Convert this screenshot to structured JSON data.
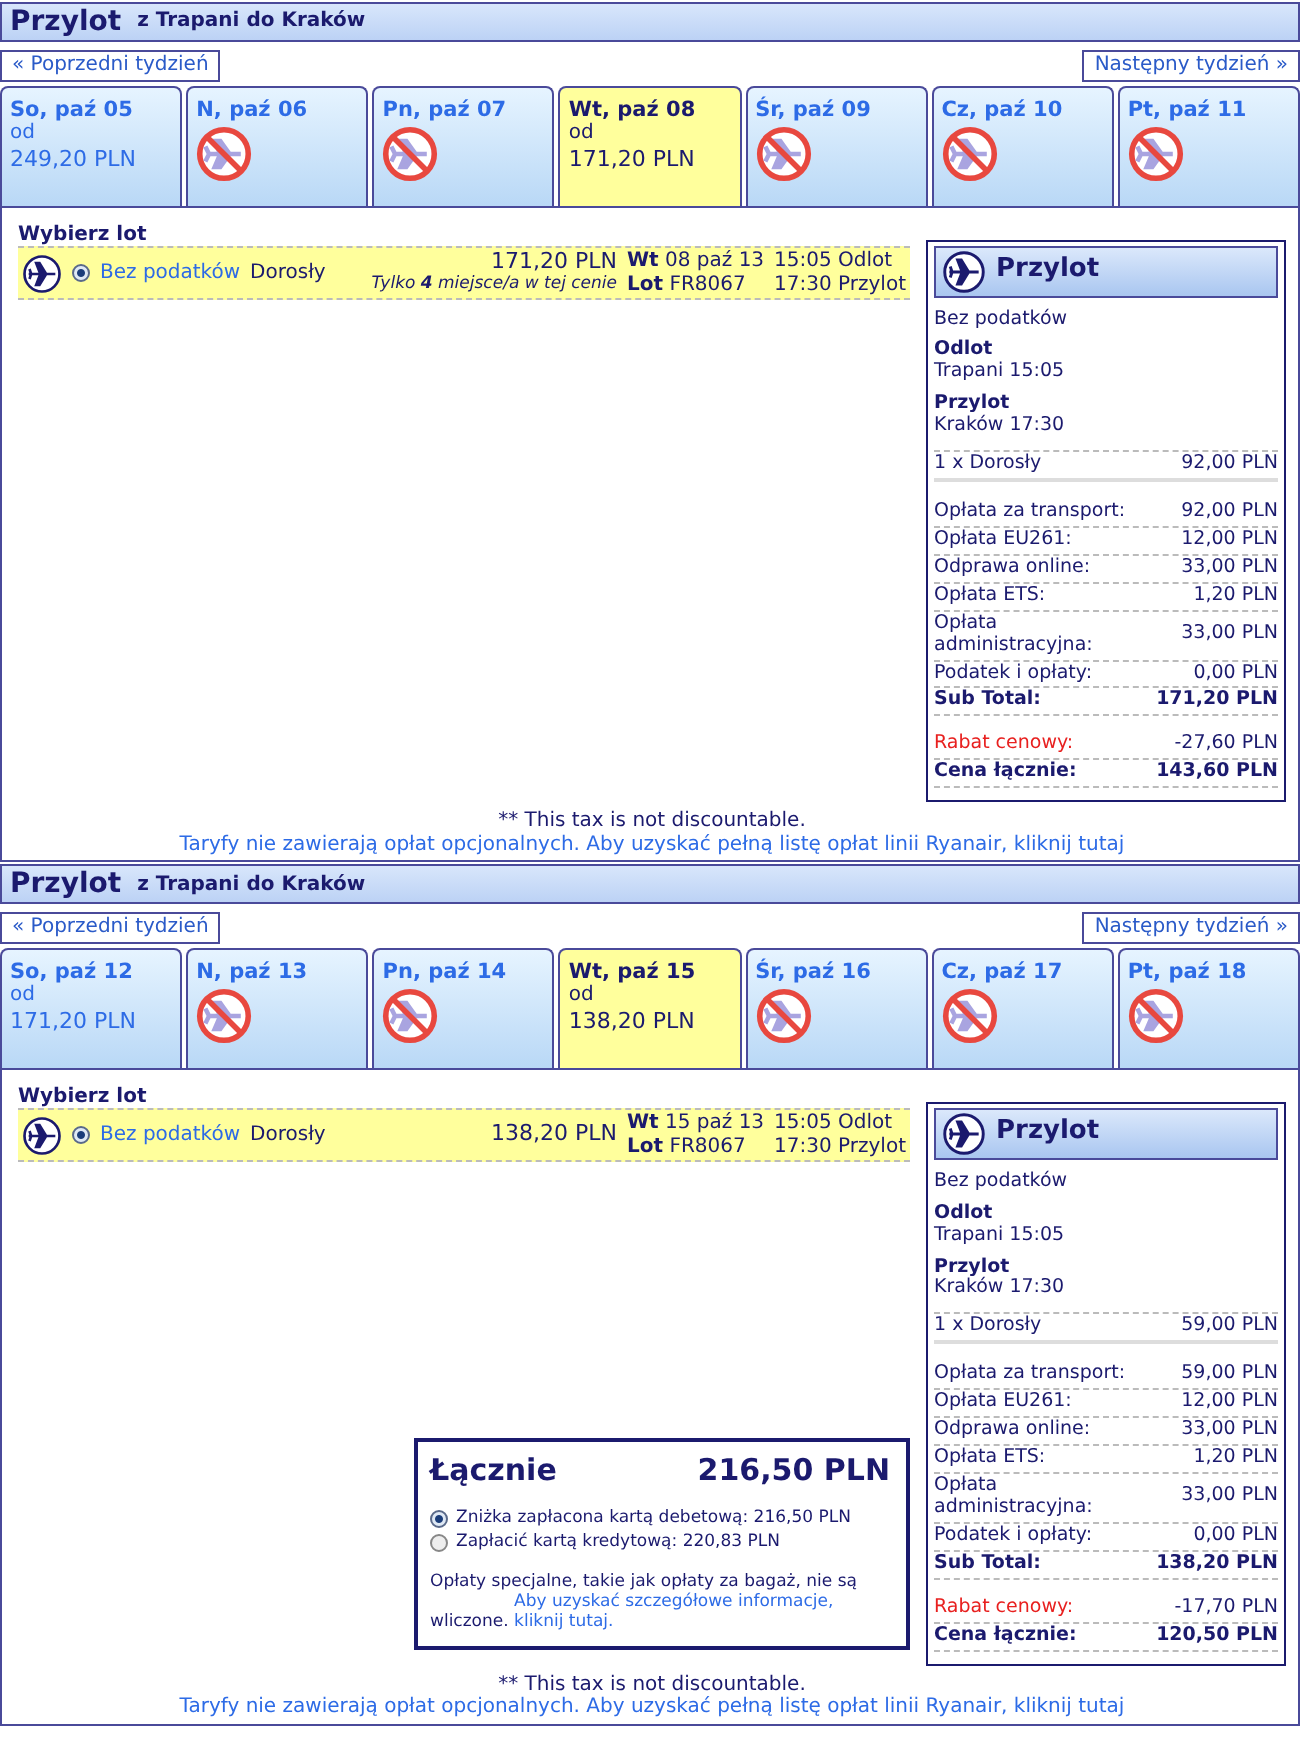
{
  "sections": [
    {
      "title": "Przylot",
      "route": "z Trapani do Kraków",
      "prev": "« Poprzedni tydzień",
      "next": "Następny tydzień »",
      "days": [
        {
          "kind": "fare",
          "label": "So, paź 05",
          "from": "od",
          "price": "249,20 PLN",
          "selected": false
        },
        {
          "kind": "none",
          "label": "N, paź 06",
          "selected": false
        },
        {
          "kind": "none",
          "label": "Pn, paź 07",
          "selected": false
        },
        {
          "kind": "fare",
          "label": "Wt, paź 08",
          "from": "od",
          "price": "171,20 PLN",
          "selected": true
        },
        {
          "kind": "none",
          "label": "Śr, paź 09",
          "selected": false
        },
        {
          "kind": "none",
          "label": "Cz, paź 10",
          "selected": false
        },
        {
          "kind": "none",
          "label": "Pt, paź 11",
          "selected": false
        }
      ],
      "choose": "Wybierz lot",
      "flight": {
        "selected": true,
        "fare": "Bez podatków",
        "passenger": "Dorosły",
        "price": "171,20 PLN",
        "note": "Tylko **4** miejsce/a w tej cenie",
        "day": "Wt",
        "date": "08 paź 13",
        "flight_label": "Lot",
        "flight_no": "FR8067",
        "depart": "15:05 Odlot",
        "arrive": "17:30 Przylot"
      },
      "summary": {
        "title": "Przylot",
        "fare": "Bez podatków",
        "depart_label": "Odlot",
        "depart": "Trapani 15:05",
        "arrive_label": "Przylot",
        "arrive": "Kraków 17:30",
        "lines": [
          {
            "kind": "passenger",
            "label": "1 x Dorosły",
            "value": "92,00 PLN"
          },
          {
            "kind": "fee",
            "label": "Opłata za transport:",
            "value": "92,00 PLN"
          },
          {
            "kind": "fee",
            "label": "Opłata EU261:",
            "value": "12,00 PLN"
          },
          {
            "kind": "fee",
            "label": "Odprawa online:",
            "value": "33,00 PLN"
          },
          {
            "kind": "fee",
            "label": "Opłata ETS:",
            "value": "1,20 PLN"
          },
          {
            "kind": "fee",
            "label": "Opłata administracyjna:",
            "value": "33,00 PLN"
          },
          {
            "kind": "fee",
            "label": "Podatek i opłaty:",
            "value": "0,00 PLN"
          },
          {
            "kind": "subtotal",
            "label": "Sub Total:",
            "value": "171,20 PLN"
          },
          {
            "kind": "discount",
            "label": "Rabat cenowy:",
            "value": "-27,60 PLN"
          },
          {
            "kind": "total",
            "label": "Cena łącznie:",
            "value": "143,60 PLN"
          }
        ]
      },
      "footnote": "** This tax is not discountable.",
      "fees_link": "Taryfy nie zawierają opłat opcjonalnych. Aby uzyskać pełną listę opłat linii Ryanair, kliknij tutaj"
    },
    {
      "title": "Przylot",
      "route": "z Trapani do Kraków",
      "prev": "« Poprzedni tydzień",
      "next": "Następny tydzień »",
      "days": [
        {
          "kind": "fare",
          "label": "So, paź 12",
          "from": "od",
          "price": "171,20 PLN",
          "selected": false
        },
        {
          "kind": "none",
          "label": "N, paź 13",
          "selected": false
        },
        {
          "kind": "none",
          "label": "Pn, paź 14",
          "selected": false
        },
        {
          "kind": "fare",
          "label": "Wt, paź 15",
          "from": "od",
          "price": "138,20 PLN",
          "selected": true
        },
        {
          "kind": "none",
          "label": "Śr, paź 16",
          "selected": false
        },
        {
          "kind": "none",
          "label": "Cz, paź 17",
          "selected": false
        },
        {
          "kind": "none",
          "label": "Pt, paź 18",
          "selected": false
        }
      ],
      "choose": "Wybierz lot",
      "flight": {
        "selected": true,
        "fare": "Bez podatków",
        "passenger": "Dorosły",
        "price": "138,20 PLN",
        "day": "Wt",
        "date": "15 paź 13",
        "flight_label": "Lot",
        "flight_no": "FR8067",
        "depart": "15:05 Odlot",
        "arrive": "17:30 Przylot"
      },
      "total_box": {
        "title": "Łącznie",
        "amount": "216,50 PLN",
        "options": [
          {
            "label": "Zniżka zapłacona kartą debetową: 216,50 PLN",
            "selected": true
          },
          {
            "label": "Zapłacić kartą kredytową: 220,83 PLN",
            "selected": false
          }
        ],
        "note": "Opłaty specjalne, takie jak opłaty za bagaż, nie są wliczone.",
        "link": "Aby uzyskać szczegółowe informacje, kliknij tutaj."
      },
      "summary": {
        "title": "Przylot",
        "fare": "Bez podatków",
        "depart_label": "Odlot",
        "depart": "Trapani 15:05",
        "arrive_label": "Przylot",
        "arrive": "Kraków 17:30",
        "lines": [
          {
            "kind": "passenger",
            "label": "1 x Dorosły",
            "value": "59,00 PLN"
          },
          {
            "kind": "fee",
            "label": "Opłata za transport:",
            "value": "59,00 PLN"
          },
          {
            "kind": "fee",
            "label": "Opłata EU261:",
            "value": "12,00 PLN"
          },
          {
            "kind": "fee",
            "label": "Odprawa online:",
            "value": "33,00 PLN"
          },
          {
            "kind": "fee",
            "label": "Opłata ETS:",
            "value": "1,20 PLN"
          },
          {
            "kind": "fee",
            "label": "Opłata administracyjna:",
            "value": "33,00 PLN"
          },
          {
            "kind": "fee",
            "label": "Podatek i opłaty:",
            "value": "0,00 PLN"
          },
          {
            "kind": "subtotal",
            "label": "Sub Total:",
            "value": "138,20 PLN"
          },
          {
            "kind": "discount",
            "label": "Rabat cenowy:",
            "value": "-17,70 PLN"
          },
          {
            "kind": "total",
            "label": "Cena łącznie:",
            "value": "120,50 PLN"
          }
        ]
      },
      "footnote": "** This tax is not discountable.",
      "fees_link": "Taryfy nie zawierają opłat opcjonalnych. Aby uzyskać pełną listę opłat linii Ryanair, kliknij tutaj"
    }
  ]
}
